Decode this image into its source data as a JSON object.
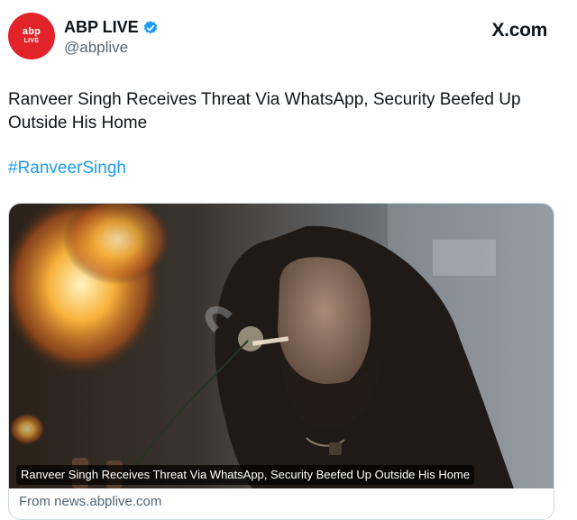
{
  "tweet": {
    "avatar_text_top": "abp",
    "avatar_text_bottom": "LIVE",
    "display_name": "ABP LIVE",
    "handle": "@abplive",
    "brand": "X.com",
    "text": "Ranveer Singh Receives Threat Via WhatsApp, Security Beefed Up Outside His Home",
    "hashtag": "#RanveerSingh"
  },
  "card": {
    "caption": "Ranveer Singh Receives Threat Via WhatsApp, Security Beefed Up Outside His Home",
    "source": "From news.abplive.com"
  },
  "colors": {
    "avatar_red": "#e2242a",
    "verified_blue": "#1d9bf0",
    "hashtag_blue": "#1d9bf0"
  }
}
